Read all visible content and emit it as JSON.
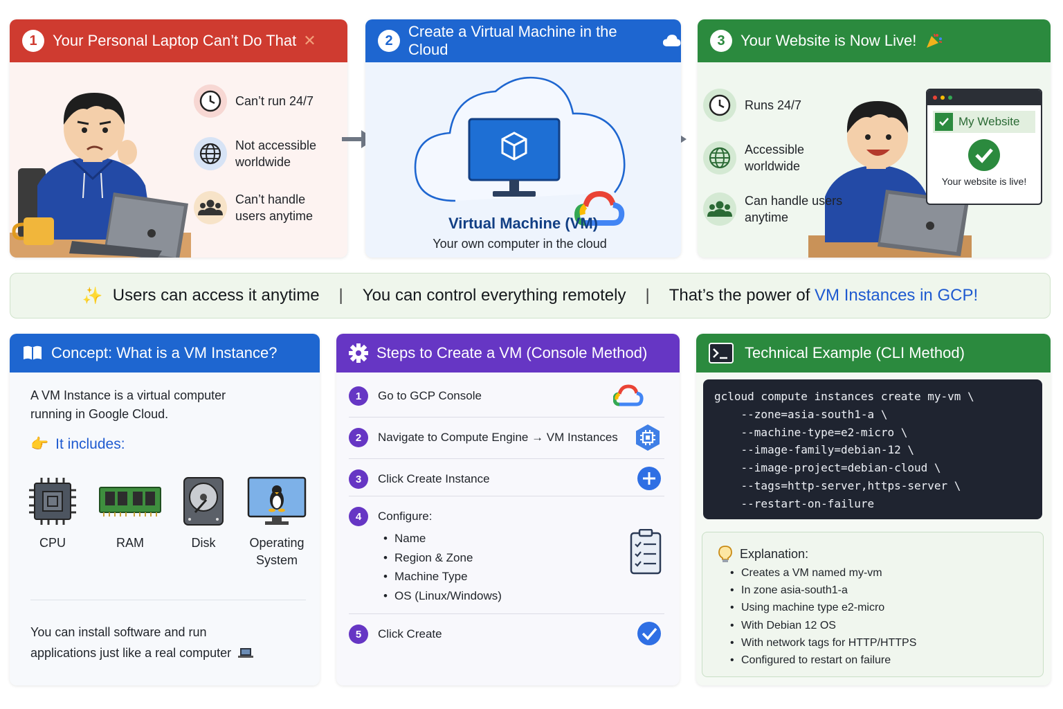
{
  "panel1": {
    "number": "1",
    "title": "Your Personal Laptop Can’t Do That",
    "title_glyph": "✕",
    "features": [
      {
        "icon": "clock-icon",
        "lines": [
          "Can’t run 24/7"
        ]
      },
      {
        "icon": "globe-icon",
        "lines": [
          "Not accessible",
          "worldwide"
        ]
      },
      {
        "icon": "users-icon",
        "lines": [
          "Can’t handle",
          "users anytime"
        ]
      }
    ]
  },
  "panel2": {
    "number": "2",
    "title": "Create a Virtual Machine in the Cloud",
    "vm_title": "Virtual Machine (VM)",
    "vm_subtitle": "Your own computer in the cloud"
  },
  "panel3": {
    "number": "3",
    "title": "Your Website is Now Live!",
    "features": [
      {
        "icon": "clock-icon",
        "lines": [
          "Runs 24/7"
        ]
      },
      {
        "icon": "globe-icon",
        "lines": [
          "Accessible",
          "worldwide"
        ]
      },
      {
        "icon": "users-icon",
        "lines": [
          "Can handle users",
          "anytime"
        ]
      }
    ],
    "website_title": "My Website",
    "website_status": "Your website is live!"
  },
  "banner": {
    "part1": "Users can access it anytime",
    "part2": "You can control everything remotely",
    "part3_prefix": "That’s the power of ",
    "part3_highlight": "VM Instances in GCP!"
  },
  "concept": {
    "title": "Concept: What is a VM Instance?",
    "intro_line1": "A VM Instance is a virtual computer",
    "intro_line2": "running in Google Cloud.",
    "includes_label": "It includes:",
    "items": [
      {
        "icon": "cpu-icon",
        "label": "CPU"
      },
      {
        "icon": "ram-icon",
        "label": "RAM"
      },
      {
        "icon": "disk-icon",
        "label": "Disk"
      },
      {
        "icon": "linux-monitor-icon",
        "label_line1": "Operating",
        "label_line2": "System"
      }
    ],
    "footer_line1": "You can install software and run",
    "footer_line2": "applications just like a real computer"
  },
  "steps": {
    "title": "Steps to Create a VM (Console Method)",
    "items": [
      {
        "num": "1",
        "text": "Go to GCP Console",
        "icon": "google-cloud-icon"
      },
      {
        "num": "2",
        "text": "Navigate to Compute Engine → VM Instances",
        "icon": "compute-engine-icon"
      },
      {
        "num": "3",
        "text": "Click Create Instance",
        "icon": "plus-icon"
      },
      {
        "num": "4",
        "text": "Configure:",
        "icon": "checklist-icon",
        "sub": [
          "Name",
          "Region & Zone",
          "Machine Type",
          "OS (Linux/Windows)"
        ]
      },
      {
        "num": "5",
        "text": "Click Create",
        "icon": "check-icon"
      }
    ]
  },
  "cli": {
    "title": "Technical Example (CLI Method)",
    "code_lines": [
      "gcloud compute instances create my-vm \\",
      "    --zone=asia-south1-a \\",
      "    --machine-type=e2-micro \\",
      "    --image-family=debian-12 \\",
      "    --image-project=debian-cloud \\",
      "    --tags=http-server,https-server \\",
      "    --restart-on-failure"
    ],
    "explanation_title": "Explanation:",
    "explanation": [
      "Creates a VM named my-vm",
      "In zone asia-south1-a",
      "Using machine type e2-micro",
      "With Debian 12 OS",
      "With network tags for HTTP/HTTPS",
      "Configured to restart on failure"
    ]
  },
  "colors": {
    "red": "#cf3b30",
    "blue": "#1e66d0",
    "green": "#2b8a3e",
    "purple": "#6636c4",
    "highlight": "#1e5ad0"
  }
}
